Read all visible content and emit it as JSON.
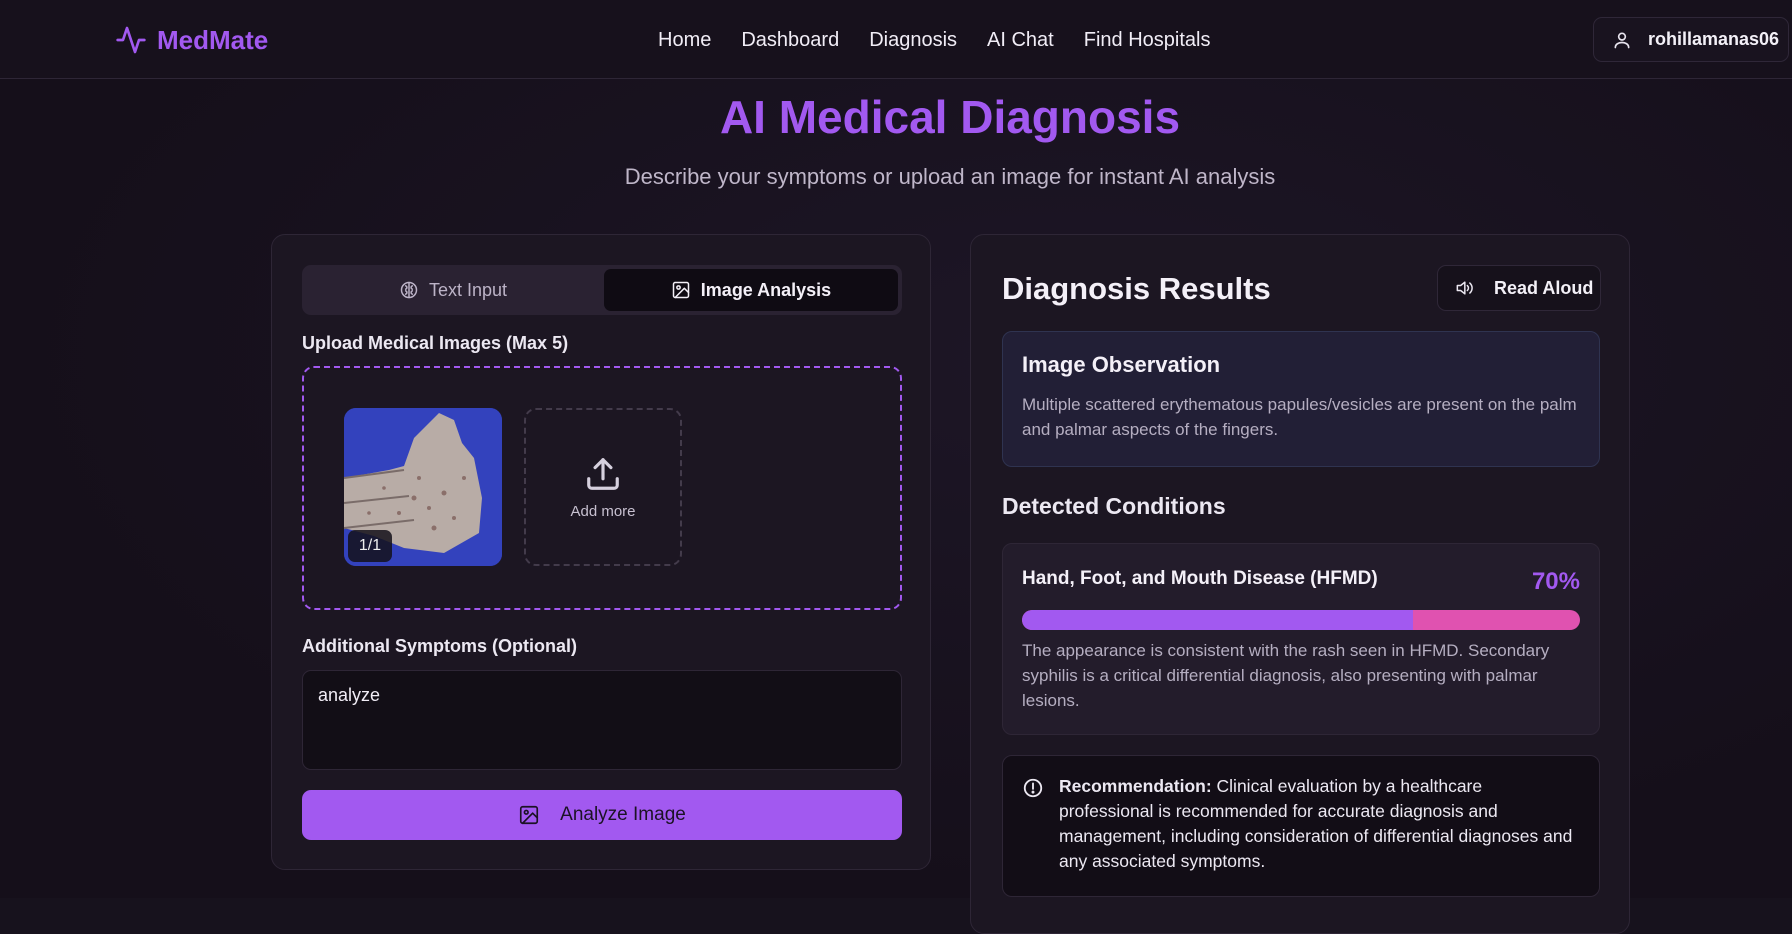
{
  "nav": {
    "brand": "MedMate",
    "links": [
      "Home",
      "Dashboard",
      "Diagnosis",
      "AI Chat",
      "Find Hospitals"
    ],
    "user": "rohillamanas06"
  },
  "hero": {
    "title": "AI Medical Diagnosis",
    "subtitle": "Describe your symptoms or upload an image for instant AI analysis"
  },
  "input_panel": {
    "tabs": [
      "Text Input",
      "Image Analysis"
    ],
    "active_tab": "Image Analysis",
    "upload_label": "Upload Medical Images (Max 5)",
    "image_counter": "1/1",
    "add_more_label": "Add more",
    "symptoms_label": "Additional Symptoms (Optional)",
    "symptoms_value": "analyze",
    "analyze_button": "Analyze Image"
  },
  "results": {
    "title": "Diagnosis Results",
    "read_aloud": "Read Aloud",
    "observation_title": "Image Observation",
    "observation_text": "Multiple scattered erythematous papules/vesicles are present on the palm and palmar aspects of the fingers.",
    "conditions_title": "Detected Conditions",
    "conditions": [
      {
        "name": "Hand, Foot, and Mouth Disease (HFMD)",
        "confidence_label": "70%",
        "confidence": 0.7,
        "description": "The appearance is consistent with the rash seen in HFMD. Secondary syphilis is a critical differential diagnosis, also presenting with palmar lesions."
      }
    ],
    "recommendation_label": "Recommendation:",
    "recommendation_text": "Clinical evaluation by a healthcare professional is recommended for accurate diagnosis and management, including consideration of differential diagnoses and any associated symptoms."
  },
  "colors": {
    "accent": "#a259f0",
    "secondary_accent": "#e052b0",
    "background": "#17121d"
  }
}
